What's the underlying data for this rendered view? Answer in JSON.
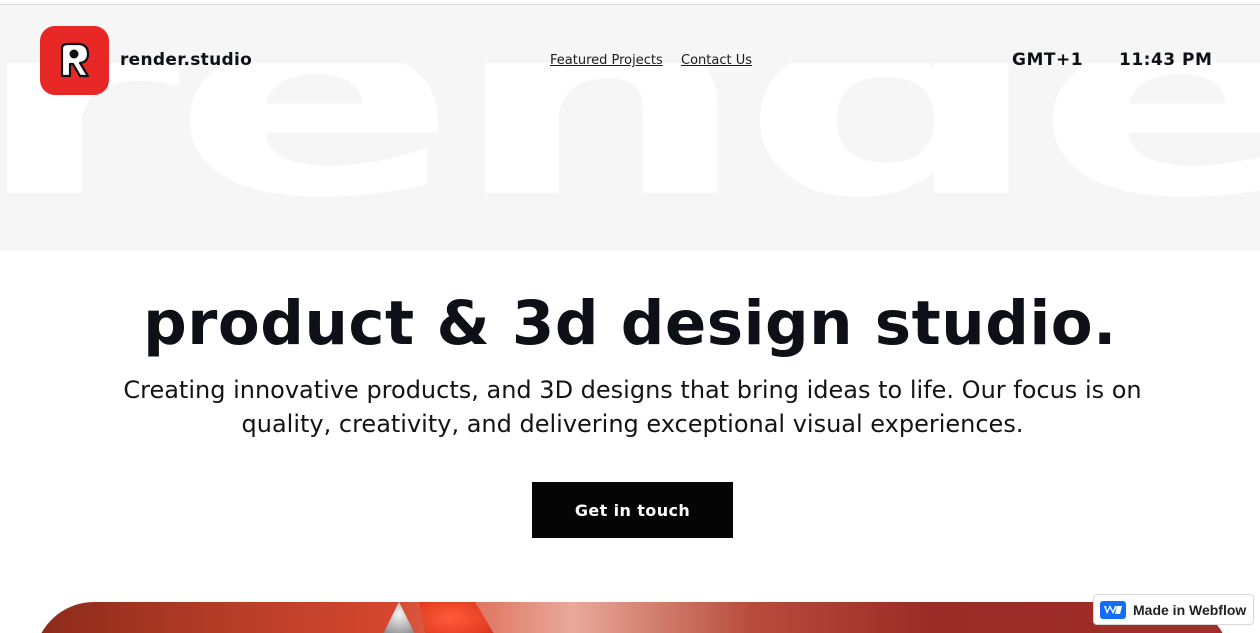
{
  "header": {
    "brand_name": "render.studio",
    "nav": [
      {
        "label": "Featured Projects"
      },
      {
        "label": "Contact Us"
      }
    ],
    "timezone": "GMT+1",
    "time": "11:43 PM"
  },
  "background_word": "render",
  "hero": {
    "headline": "product & 3d design studio.",
    "subtext": "Creating innovative products,  and 3D designs that bring ideas to life. Our focus is on quality, creativity, and delivering exceptional visual experiences.",
    "cta_label": "Get in touch"
  },
  "badge": {
    "label": "Made in Webflow"
  },
  "colors": {
    "brand": "#e82727",
    "text": "#0d1117",
    "band": "#f6f6f6",
    "cta": "#050505"
  }
}
